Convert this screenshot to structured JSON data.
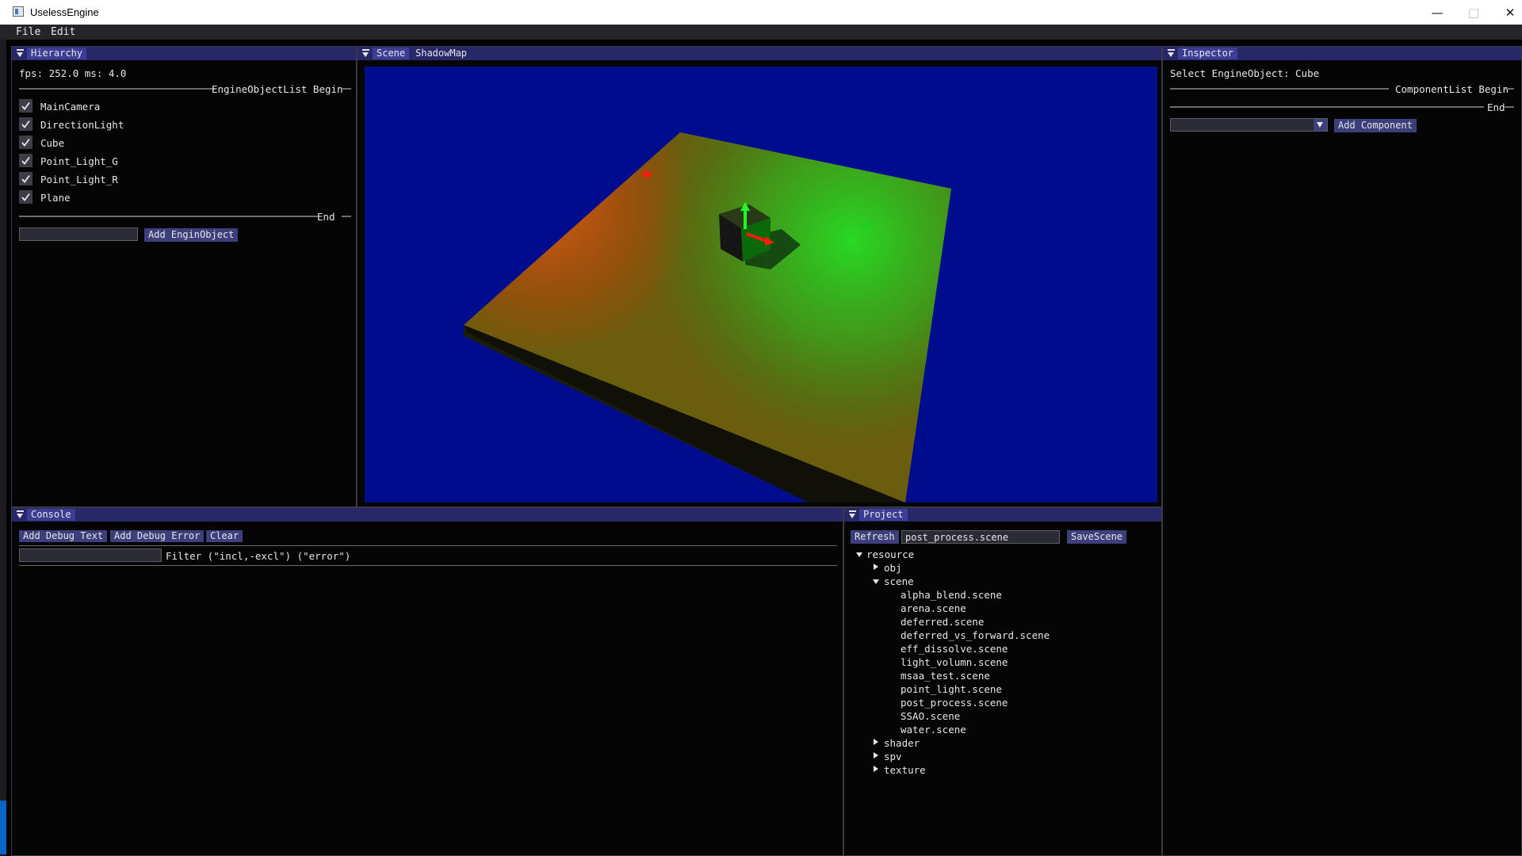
{
  "window": {
    "title": "UselessEngine"
  },
  "menu": {
    "items": [
      "File",
      "Edit"
    ]
  },
  "hierarchy": {
    "tab": "Hierarchy",
    "fps_text": "fps: 252.0 ms: 4.0",
    "list_begin": "EngineObjectList Begin",
    "objects": [
      {
        "label": "MainCamera",
        "checked": true
      },
      {
        "label": "DirectionLight",
        "checked": true
      },
      {
        "label": "Cube",
        "checked": true
      },
      {
        "label": "Point_Light_G",
        "checked": true
      },
      {
        "label": "Point_Light_R",
        "checked": true
      },
      {
        "label": "Plane",
        "checked": true
      }
    ],
    "list_end": "End",
    "name_input_value": "",
    "add_button": "Add EnginObject"
  },
  "scene": {
    "tabs": [
      "Scene",
      "ShadowMap"
    ],
    "active_tab": "Scene",
    "colors": {
      "background": "#000c8e",
      "red_light": "#ff2a10",
      "green_light": "#2aff2a"
    }
  },
  "inspector": {
    "tab": "Inspector",
    "selected_text": "Select EngineObject: Cube",
    "list_begin": "ComponentList Begin",
    "list_end": "End",
    "component_select_value": "",
    "add_button": "Add Component"
  },
  "console": {
    "tab": "Console",
    "buttons": {
      "add_debug_text": "Add Debug Text",
      "add_debug_error": "Add Debug Error",
      "clear": "Clear"
    },
    "filter_value": "",
    "filter_label": "Filter (\"incl,-excl\") (\"error\")"
  },
  "project": {
    "tab": "Project",
    "refresh_button": "Refresh",
    "scene_name_value": "post_process.scene",
    "save_button": "SaveScene",
    "tree": {
      "root": "resource",
      "folders": [
        {
          "label": "obj",
          "expanded": false
        },
        {
          "label": "scene",
          "expanded": true,
          "files": [
            "alpha_blend.scene",
            "arena.scene",
            "deferred.scene",
            "deferred_vs_forward.scene",
            "eff_dissolve.scene",
            "light_volumn.scene",
            "msaa_test.scene",
            "point_light.scene",
            "post_process.scene",
            "SSAO.scene",
            "water.scene"
          ]
        },
        {
          "label": "shader",
          "expanded": false
        },
        {
          "label": "spv",
          "expanded": false
        },
        {
          "label": "texture",
          "expanded": false
        }
      ]
    }
  }
}
